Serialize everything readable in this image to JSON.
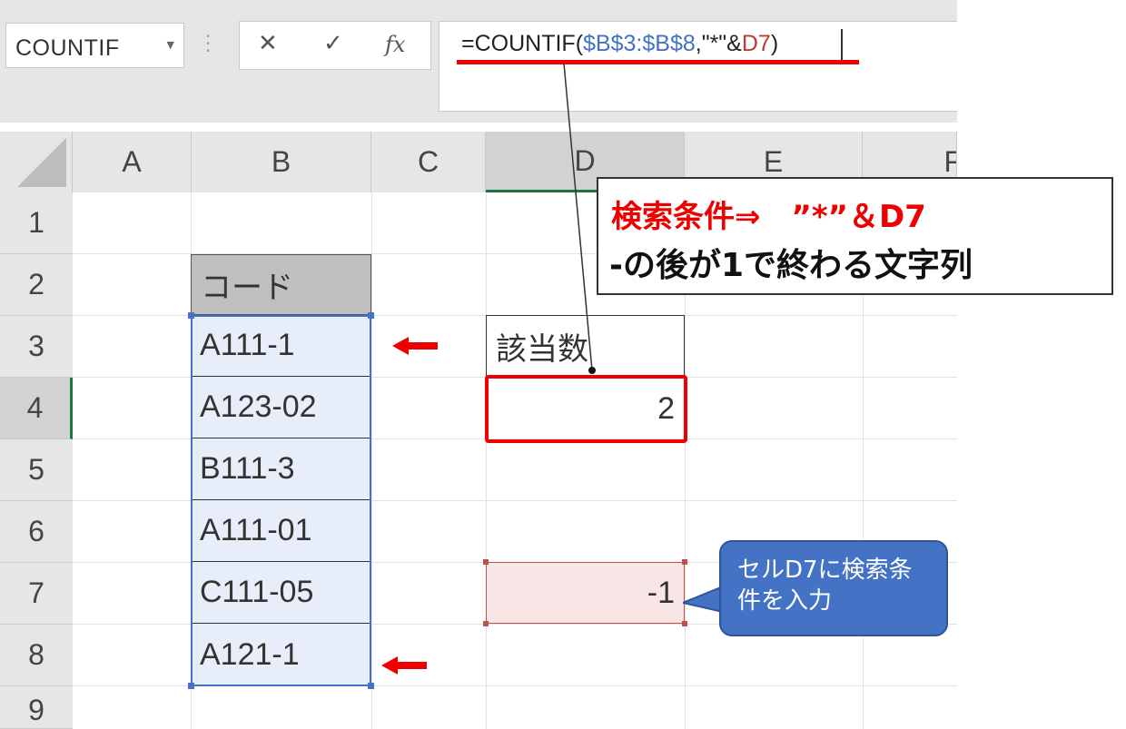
{
  "formula_bar": {
    "name_box": "COUNTIF",
    "cancel_icon": "✕",
    "enter_icon": "✓",
    "fx_icon": "fx",
    "formula_prefix": "=COUNTIF(",
    "formula_range": "$B$3:$B$8",
    "formula_mid": ",\"*\"&",
    "formula_ref": "D7",
    "formula_suffix": ")"
  },
  "columns": [
    "A",
    "B",
    "C",
    "D",
    "E",
    "F"
  ],
  "rows": [
    "1",
    "2",
    "3",
    "4",
    "5",
    "6",
    "7",
    "8",
    "9"
  ],
  "cells": {
    "B2": "コード",
    "B3": "A111-1",
    "B4": "A123-02",
    "B5": "B111-3",
    "B6": "A111-01",
    "B7": "C111-05",
    "B8": "A121-1",
    "D3": "該当数",
    "D4": "2",
    "D7": "-1"
  },
  "annotations": {
    "condition_title": "検索条件⇒　”*”＆D7",
    "condition_desc": "-の後が1で終わる文字列",
    "bubble_text": "セルD7に検索条件を入力"
  },
  "colors": {
    "accent_red": "#ee0000",
    "selection_blue": "#4472c4",
    "bubble_fill": "#4472c4"
  }
}
